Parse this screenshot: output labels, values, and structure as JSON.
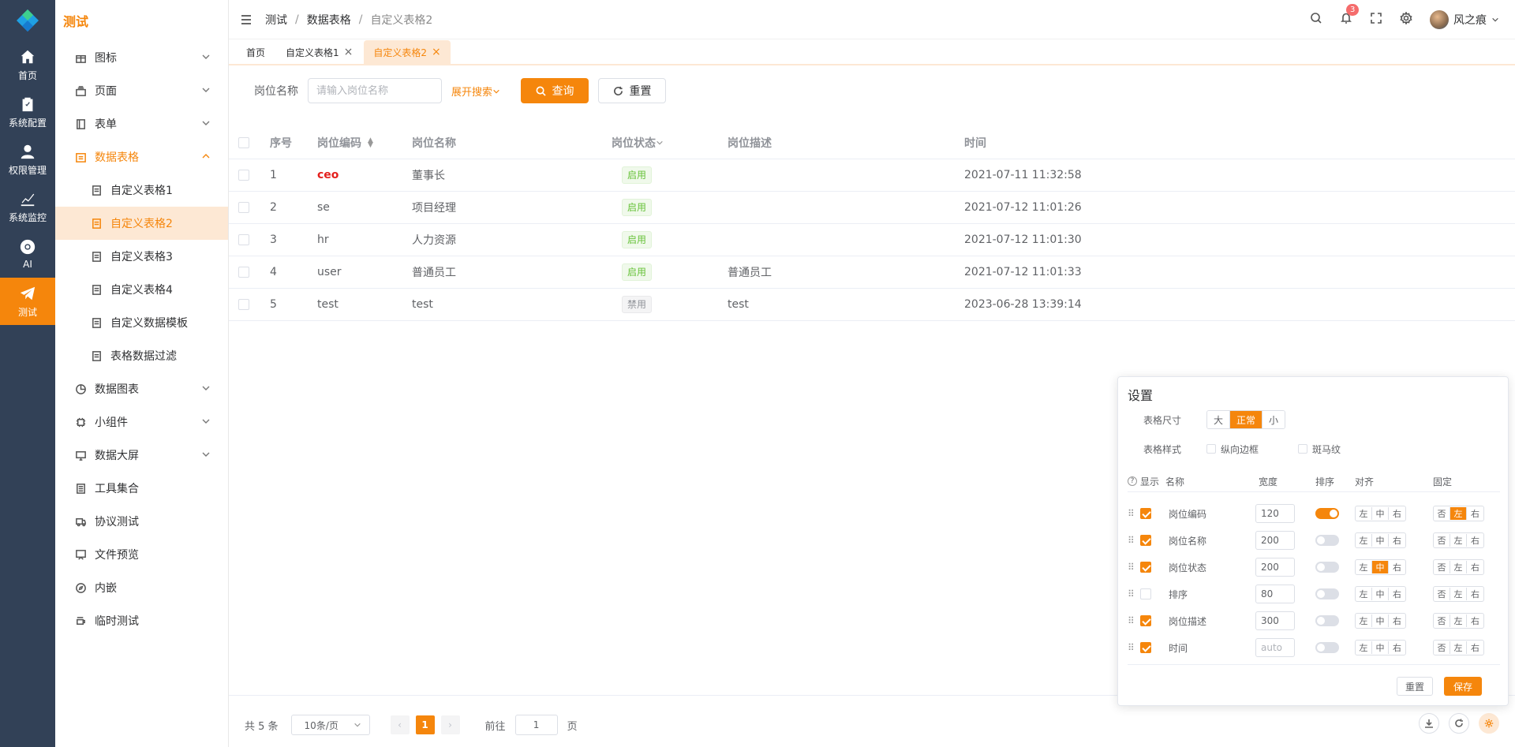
{
  "rail": {
    "items": [
      {
        "label": "首页",
        "icon": "home-icon"
      },
      {
        "label": "系统配置",
        "icon": "clipboard-icon"
      },
      {
        "label": "权限管理",
        "icon": "user-icon"
      },
      {
        "label": "系统监控",
        "icon": "chart-icon"
      },
      {
        "label": "AI",
        "icon": "chrome-icon"
      },
      {
        "label": "测试",
        "icon": "send-icon"
      }
    ]
  },
  "menu": {
    "title": "测试",
    "items": [
      {
        "label": "图标"
      },
      {
        "label": "页面"
      },
      {
        "label": "表单"
      },
      {
        "label": "数据表格"
      },
      {
        "label": "自定义表格1"
      },
      {
        "label": "自定义表格2"
      },
      {
        "label": "自定义表格3"
      },
      {
        "label": "自定义表格4"
      },
      {
        "label": "自定义数据模板"
      },
      {
        "label": "表格数据过滤"
      },
      {
        "label": "数据图表"
      },
      {
        "label": "小组件"
      },
      {
        "label": "数据大屏"
      },
      {
        "label": "工具集合"
      },
      {
        "label": "协议测试"
      },
      {
        "label": "文件预览"
      },
      {
        "label": "内嵌"
      },
      {
        "label": "临时测试"
      }
    ]
  },
  "header": {
    "breadcrumb": [
      "测试",
      "数据表格",
      "自定义表格2"
    ],
    "separator": "/",
    "notification_count": "3",
    "username": "风之痕"
  },
  "tabs": [
    {
      "label": "首页"
    },
    {
      "label": "自定义表格1"
    },
    {
      "label": "自定义表格2"
    }
  ],
  "search": {
    "label": "岗位名称",
    "placeholder": "请输入岗位名称",
    "expand_label": "展开搜索",
    "query_label": "查询",
    "reset_label": "重置"
  },
  "table": {
    "headers": {
      "index": "序号",
      "code": "岗位编码",
      "name": "岗位名称",
      "status": "岗位状态",
      "desc": "岗位描述",
      "time": "时间"
    },
    "rows": [
      {
        "index": "1",
        "code": "ceo",
        "name": "董事长",
        "status": "启用",
        "desc": "",
        "time": "2021-07-11 11:32:58"
      },
      {
        "index": "2",
        "code": "se",
        "name": "项目经理",
        "status": "启用",
        "desc": "",
        "time": "2021-07-12 11:01:26"
      },
      {
        "index": "3",
        "code": "hr",
        "name": "人力资源",
        "status": "启用",
        "desc": "",
        "time": "2021-07-12 11:01:30"
      },
      {
        "index": "4",
        "code": "user",
        "name": "普通员工",
        "status": "启用",
        "desc": "普通员工",
        "time": "2021-07-12 11:01:33"
      },
      {
        "index": "5",
        "code": "test",
        "name": "test",
        "status": "禁用",
        "desc": "test",
        "time": "2023-06-28 13:39:14"
      }
    ]
  },
  "pagination": {
    "total_text": "共 5 条",
    "page_size": "10条/页",
    "current_page": "1",
    "goto_label": "前往",
    "goto_value": "1",
    "page_suffix": "页"
  },
  "settings": {
    "title": "设置",
    "size_label": "表格尺寸",
    "size_options": [
      "大",
      "正常",
      "小"
    ],
    "style_label": "表格样式",
    "border_label": "纵向边框",
    "stripe_label": "斑马纹",
    "col_headers": {
      "help": "?",
      "show": "显示",
      "name": "名称",
      "width": "宽度",
      "sort": "排序",
      "align": "对齐",
      "fixed": "固定"
    },
    "columns": [
      {
        "name": "岗位编码",
        "width": "120"
      },
      {
        "name": "岗位名称",
        "width": "200"
      },
      {
        "name": "岗位状态",
        "width": "200"
      },
      {
        "name": "排序",
        "width": "80"
      },
      {
        "name": "岗位描述",
        "width": "300"
      },
      {
        "name": "时间",
        "width": "auto"
      }
    ],
    "align_options": [
      "左",
      "中",
      "右"
    ],
    "fixed_options": [
      "否",
      "左",
      "右"
    ],
    "reset_label": "重置",
    "save_label": "保存"
  },
  "colors": {
    "accent": "#f5860c",
    "rail_bg": "#324157",
    "active_bg": "#fde8d4"
  }
}
